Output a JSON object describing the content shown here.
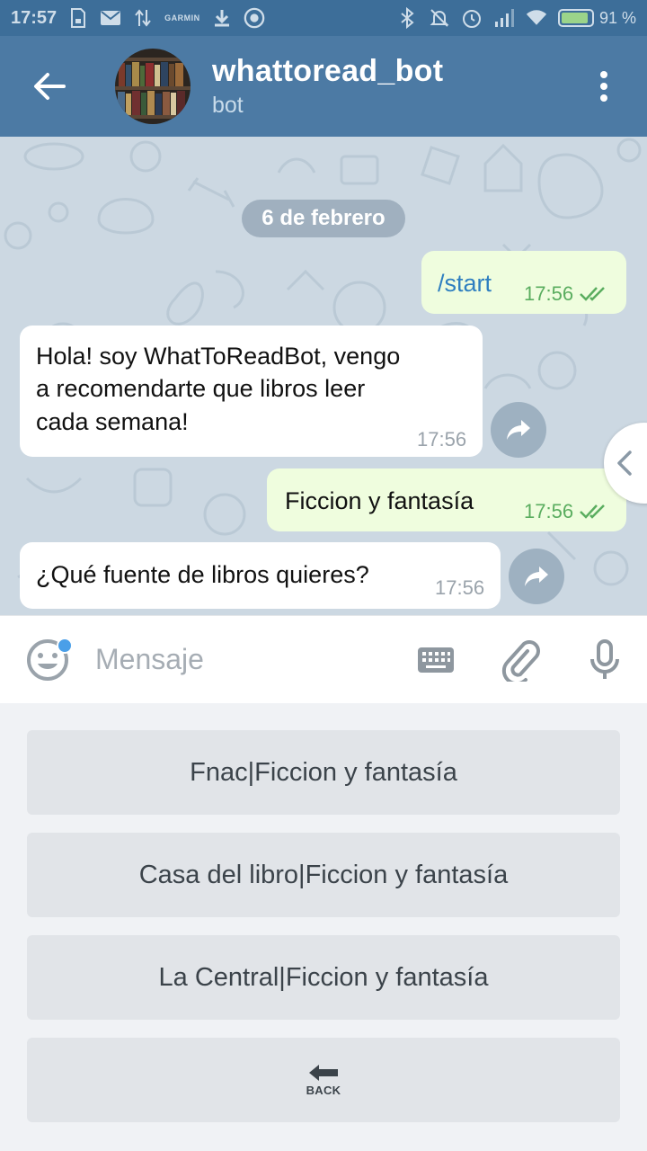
{
  "status_bar": {
    "time": "17:57",
    "garmin": "GARMIN",
    "battery_percent": "91 %",
    "battery_level": 0.91
  },
  "header": {
    "title": "whattoread_bot",
    "subtitle": "bot"
  },
  "chat": {
    "date_chip": "6 de febrero",
    "messages": [
      {
        "direction": "out",
        "text": "/start",
        "time": "17:56",
        "status": "read"
      },
      {
        "direction": "in",
        "lines": [
          "Hola! soy WhatToReadBot, vengo",
          "a recomendarte que libros leer",
          "cada semana!"
        ],
        "time": "17:56"
      },
      {
        "direction": "out",
        "text": "Ficcion y fantasía",
        "time": "17:56",
        "status": "read"
      },
      {
        "direction": "in",
        "text": "¿Qué fuente de libros quieres?",
        "time": "17:56"
      }
    ]
  },
  "input": {
    "placeholder": "Mensaje"
  },
  "bot_keyboard": {
    "buttons": [
      {
        "label": "Fnac|Ficcion y fantasía"
      },
      {
        "label": "Casa del libro|Ficcion y fantasía"
      },
      {
        "label": "La Central|Ficcion y fantasía"
      },
      {
        "label": "BACK",
        "icon": "back-arrow-icon"
      }
    ]
  },
  "colors": {
    "header_bg": "#4c7aa4",
    "statusbar_bg": "#3d6e99",
    "chat_bg": "#ccd8e2",
    "bubble_out": "#effdde",
    "bubble_in": "#ffffff",
    "keyboard_button": "#e1e4e8",
    "accent": "#4a9fe8"
  }
}
